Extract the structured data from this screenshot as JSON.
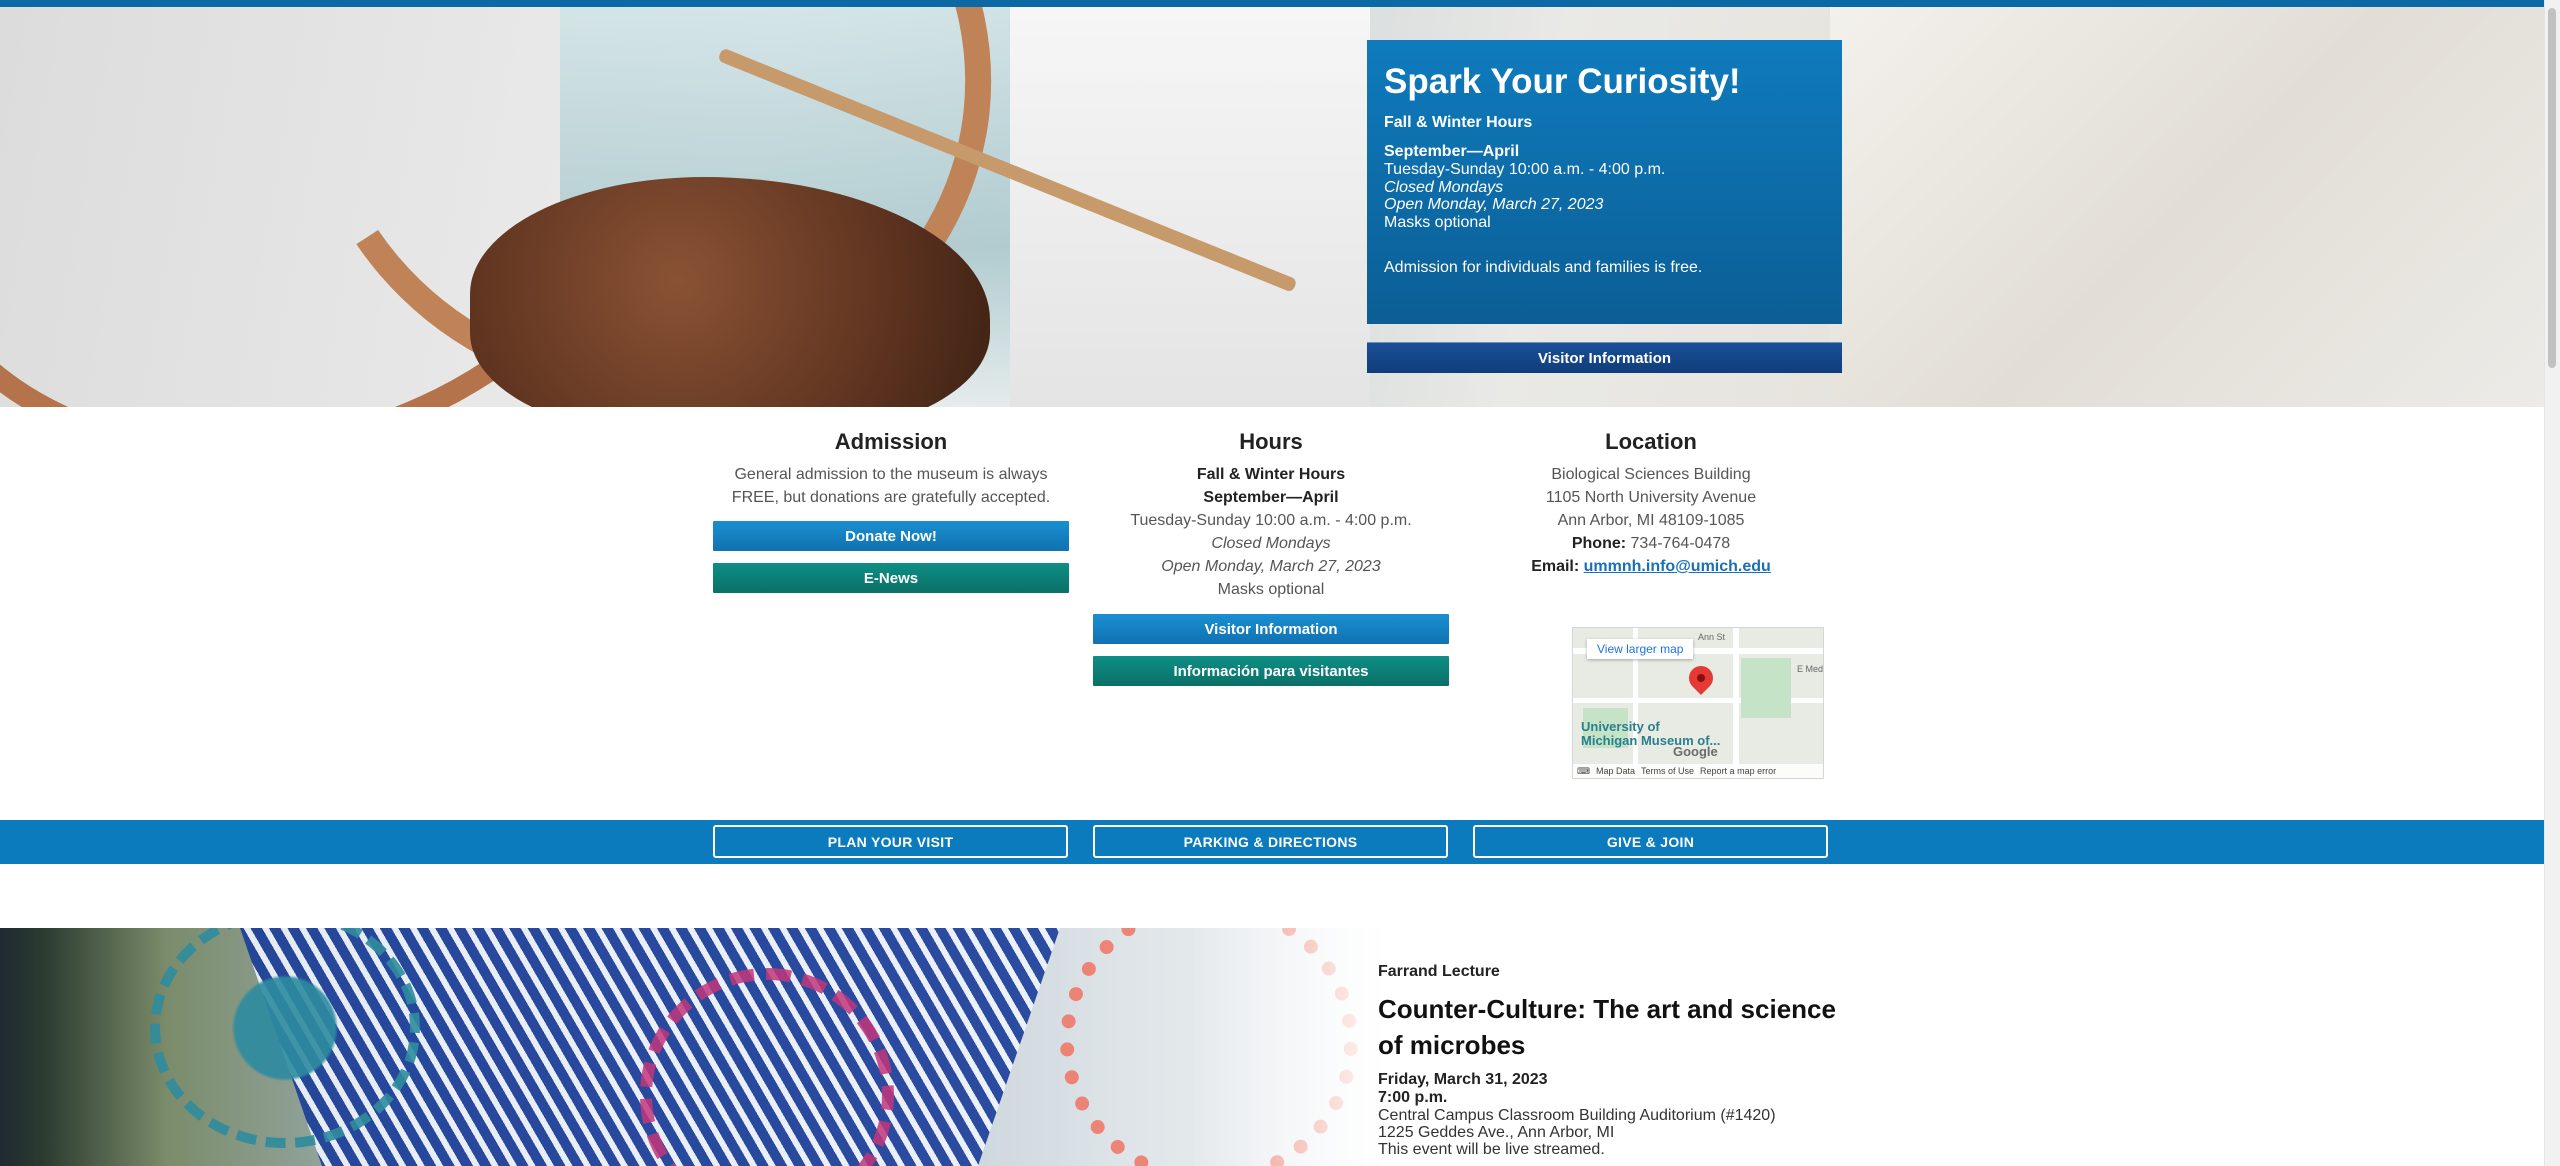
{
  "hero": {
    "title": "Spark Your Curiosity!",
    "season": "Fall & Winter Hours",
    "months": "September—April",
    "hours": "Tuesday-Sunday 10:00 a.m. - 4:00 p.m.",
    "closed": "Closed Mondays",
    "open_special": "Open Monday, March 27, 2023",
    "masks": "Masks optional",
    "admission": "Admission for individuals and families is free.",
    "visitor_button": "Visitor Information"
  },
  "admission": {
    "heading": "Admission",
    "text": "General admission to the museum is always FREE, but donations are gratefully accepted.",
    "donate_button": "Donate Now!",
    "enews_button": "E-News"
  },
  "hours": {
    "heading": "Hours",
    "season": "Fall & Winter Hours",
    "months": "September—April",
    "hours": "Tuesday-Sunday 10:00 a.m. - 4:00 p.m.",
    "closed": "Closed Mondays",
    "open_special": "Open Monday, March 27, 2023",
    "masks": "Masks optional",
    "visitor_button": "Visitor Information",
    "spanish_button": "Información para visitantes"
  },
  "location": {
    "heading": "Location",
    "building": "Biological Sciences Building",
    "street": "1105 North University Avenue",
    "city": "Ann Arbor, MI 48109-1085",
    "phone_label": "Phone:",
    "phone": "734-764-0478",
    "email_label": "Email:",
    "email": "ummnh.info@umich.edu"
  },
  "map": {
    "view_larger": "View larger map",
    "place_label_1": "University of",
    "place_label_2": "Michigan Museum of...",
    "street_1": "Ann St",
    "street_2": "E Med",
    "google": "Google",
    "map_data": "Map Data",
    "terms": "Terms of Use",
    "report": "Report a map error"
  },
  "nav": {
    "plan": "PLAN YOUR VISIT",
    "parking": "PARKING & DIRECTIONS",
    "give": "GIVE & JOIN"
  },
  "event": {
    "kicker": "Farrand Lecture",
    "title": "Counter-Culture: The art and science of microbes",
    "date": "Friday, March 31, 2023",
    "time": "7:00 p.m.",
    "venue": "Central Campus Classroom Building Auditorium (#1420)",
    "address": "1225 Geddes Ave., Ann Arbor, MI",
    "note": "This event will be live streamed."
  }
}
